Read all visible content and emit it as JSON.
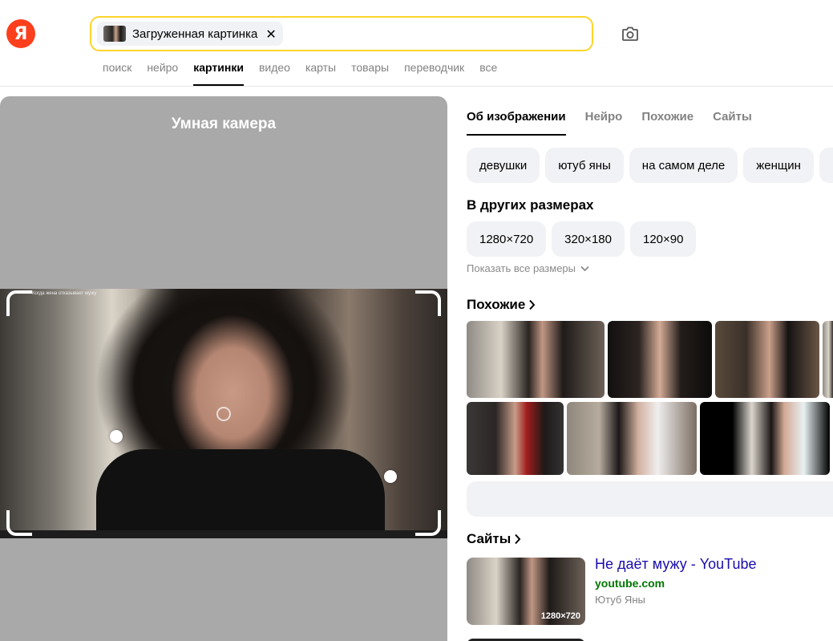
{
  "header": {
    "logo_letter": "Я",
    "search": {
      "chip_label": "Загруженная картинка",
      "chip_close": "✕"
    },
    "tabs": [
      "поиск",
      "нейро",
      "картинки",
      "видео",
      "карты",
      "товары",
      "переводчик",
      "все"
    ],
    "active_tab": "картинки"
  },
  "smart_camera": {
    "title": "Умная камера",
    "video_caption": "Когда жена отказывает мужу"
  },
  "details": {
    "tabs": [
      "Об изображении",
      "Нейро",
      "Похожие",
      "Сайты"
    ],
    "active_tab": "Об изображении",
    "tags": [
      "девушки",
      "ютуб яны",
      "на самом деле",
      "женщин"
    ],
    "sizes_title": "В других размерах",
    "sizes": [
      "1280×720",
      "320×180",
      "120×90"
    ],
    "show_all_sizes": "Показать все размеры",
    "similar_title": "Похожие",
    "sites_title": "Сайты",
    "site_result": {
      "title": "Не даёт мужу - YouTube",
      "url": "youtube.com",
      "description": "Ютуб Яны",
      "resolution": "1280×720"
    }
  },
  "colors": {
    "accent_yellow": "#fed42b",
    "logo_red": "#fc3f1d",
    "link_blue": "#1a0dab",
    "url_green": "#007700"
  }
}
